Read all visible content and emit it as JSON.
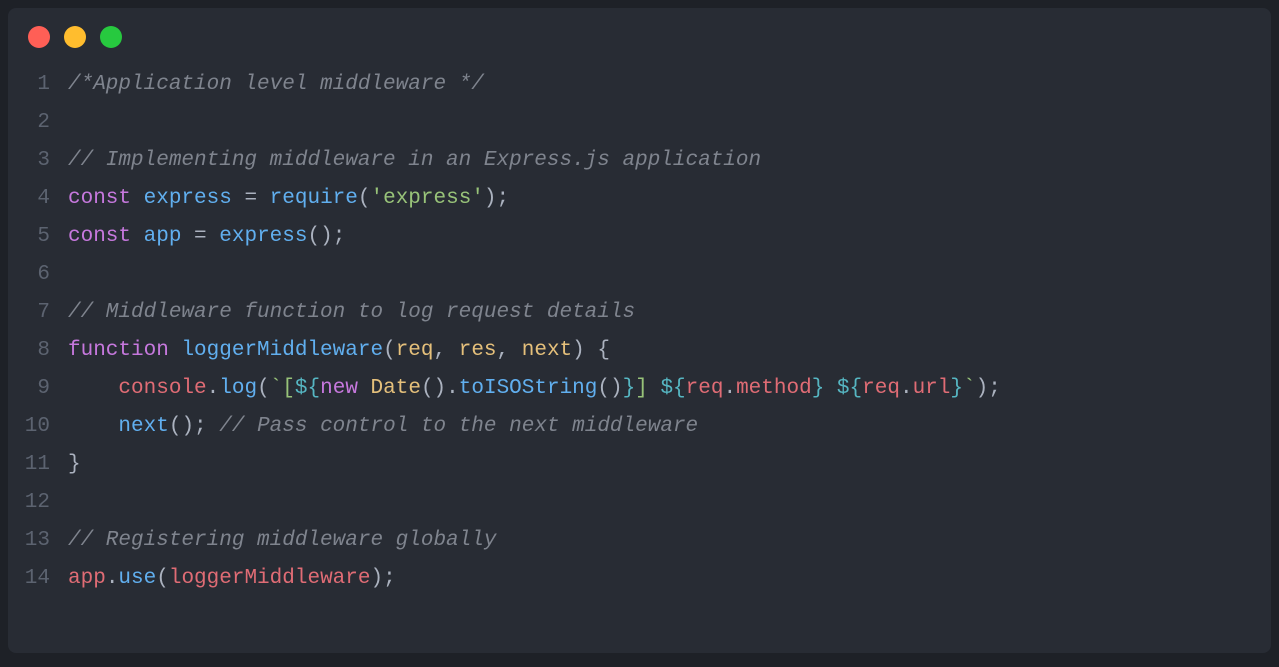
{
  "window": {
    "traffic_lights": [
      "red",
      "yellow",
      "green"
    ]
  },
  "editor": {
    "lines": [
      {
        "num": "1",
        "tokens": [
          [
            "c-comment",
            "/*Application level middleware */"
          ]
        ]
      },
      {
        "num": "2",
        "tokens": []
      },
      {
        "num": "3",
        "tokens": [
          [
            "c-comment",
            "// Implementing middleware in an Express.js application"
          ]
        ]
      },
      {
        "num": "4",
        "tokens": [
          [
            "c-keyword",
            "const"
          ],
          [
            "",
            " "
          ],
          [
            "c-const",
            "express"
          ],
          [
            "",
            " "
          ],
          [
            "c-op",
            "="
          ],
          [
            "",
            " "
          ],
          [
            "c-funcname",
            "require"
          ],
          [
            "c-op",
            "("
          ],
          [
            "c-string",
            "'express'"
          ],
          [
            "c-op",
            ");"
          ]
        ]
      },
      {
        "num": "5",
        "tokens": [
          [
            "c-keyword",
            "const"
          ],
          [
            "",
            " "
          ],
          [
            "c-const",
            "app"
          ],
          [
            "",
            " "
          ],
          [
            "c-op",
            "="
          ],
          [
            "",
            " "
          ],
          [
            "c-funcname",
            "express"
          ],
          [
            "c-op",
            "();"
          ]
        ]
      },
      {
        "num": "6",
        "tokens": []
      },
      {
        "num": "7",
        "tokens": [
          [
            "c-comment",
            "// Middleware function to log request details"
          ]
        ]
      },
      {
        "num": "8",
        "tokens": [
          [
            "c-keyword",
            "function"
          ],
          [
            "",
            " "
          ],
          [
            "c-funcname",
            "loggerMiddleware"
          ],
          [
            "c-op",
            "("
          ],
          [
            "c-param",
            "req"
          ],
          [
            "c-op",
            ", "
          ],
          [
            "c-param",
            "res"
          ],
          [
            "c-op",
            ", "
          ],
          [
            "c-param",
            "next"
          ],
          [
            "c-op",
            ") {"
          ]
        ]
      },
      {
        "num": "9",
        "tokens": [
          [
            "",
            "    "
          ],
          [
            "c-prop",
            "console"
          ],
          [
            "c-op",
            "."
          ],
          [
            "c-method",
            "log"
          ],
          [
            "c-op",
            "("
          ],
          [
            "c-tmpl",
            "`["
          ],
          [
            "c-tmplbrace",
            "${"
          ],
          [
            "c-new",
            "new"
          ],
          [
            "",
            " "
          ],
          [
            "c-class",
            "Date"
          ],
          [
            "c-op",
            "()."
          ],
          [
            "c-method",
            "toISOString"
          ],
          [
            "c-op",
            "()"
          ],
          [
            "c-tmplbrace",
            "}"
          ],
          [
            "c-tmpl",
            "] "
          ],
          [
            "c-tmplbrace",
            "${"
          ],
          [
            "c-tmplexpr",
            "req"
          ],
          [
            "c-op",
            "."
          ],
          [
            "c-tmplexpr",
            "method"
          ],
          [
            "c-tmplbrace",
            "}"
          ],
          [
            "c-tmpl",
            " "
          ],
          [
            "c-tmplbrace",
            "${"
          ],
          [
            "c-tmplexpr",
            "req"
          ],
          [
            "c-op",
            "."
          ],
          [
            "c-tmplexpr",
            "url"
          ],
          [
            "c-tmplbrace",
            "}"
          ],
          [
            "c-tmpl",
            "`"
          ],
          [
            "c-op",
            ");"
          ]
        ]
      },
      {
        "num": "10",
        "tokens": [
          [
            "",
            "    "
          ],
          [
            "c-funcname",
            "next"
          ],
          [
            "c-op",
            "(); "
          ],
          [
            "c-comment",
            "// Pass control to the next middleware"
          ]
        ]
      },
      {
        "num": "11",
        "tokens": [
          [
            "c-op",
            "}"
          ]
        ]
      },
      {
        "num": "12",
        "tokens": []
      },
      {
        "num": "13",
        "tokens": [
          [
            "c-comment",
            "// Registering middleware globally"
          ]
        ]
      },
      {
        "num": "14",
        "tokens": [
          [
            "c-prop",
            "app"
          ],
          [
            "c-op",
            "."
          ],
          [
            "c-method",
            "use"
          ],
          [
            "c-op",
            "("
          ],
          [
            "c-var",
            "loggerMiddleware"
          ],
          [
            "c-op",
            ");"
          ]
        ]
      }
    ]
  }
}
